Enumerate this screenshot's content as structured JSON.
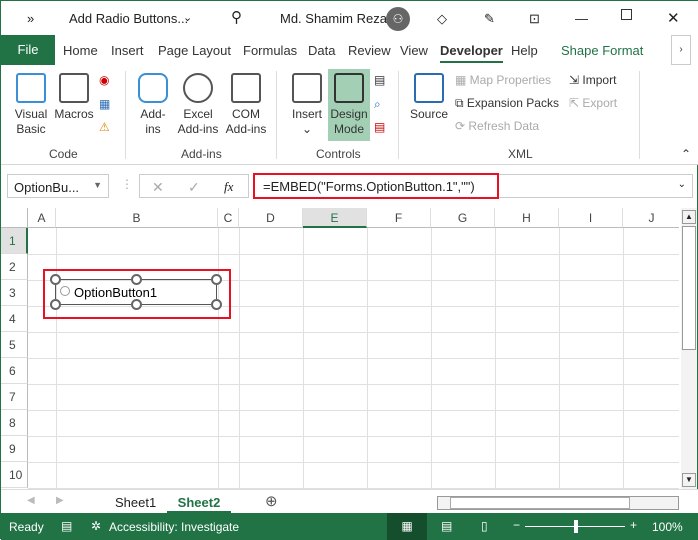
{
  "titlebar": {
    "quick_access": "»",
    "doc_title": "Add Radio Buttons...",
    "user": "Md. Shamim Reza"
  },
  "tabs": [
    "File",
    "Home",
    "Insert",
    "Page Layout",
    "Formulas",
    "Data",
    "Review",
    "View",
    "Developer",
    "Help",
    "Shape Format"
  ],
  "ribbon": {
    "code": {
      "label": "Code",
      "visual_basic": "Visual Basic",
      "macros": "Macros"
    },
    "addins": {
      "label": "Add-ins",
      "addins": "Add-ins",
      "excel_addins": "Excel Add-ins",
      "com_addins": "COM Add-ins"
    },
    "controls": {
      "label": "Controls",
      "insert": "Insert",
      "design_mode": "Design Mode"
    },
    "xml": {
      "label": "XML",
      "source": "Source",
      "map_properties": "Map Properties",
      "expansion_packs": "Expansion Packs",
      "refresh_data": "Refresh Data",
      "import": "Import",
      "export": "Export"
    }
  },
  "formula_bar": {
    "name_box": "OptionBu...",
    "fx": "fx",
    "formula": "=EMBED(\"Forms.OptionButton.1\",\"\")"
  },
  "columns": [
    "A",
    "B",
    "C",
    "D",
    "E",
    "F",
    "G",
    "H",
    "I",
    "J"
  ],
  "rows": [
    "1",
    "2",
    "3",
    "4",
    "5",
    "6",
    "7",
    "8",
    "9",
    "10"
  ],
  "control": {
    "label": "OptionButton1"
  },
  "sheets": [
    "Sheet1",
    "Sheet2"
  ],
  "status": {
    "ready": "Ready",
    "accessibility": "Accessibility: Investigate",
    "zoom": "100%"
  },
  "colors": {
    "accent": "#217346",
    "highlight": "#e81123"
  }
}
